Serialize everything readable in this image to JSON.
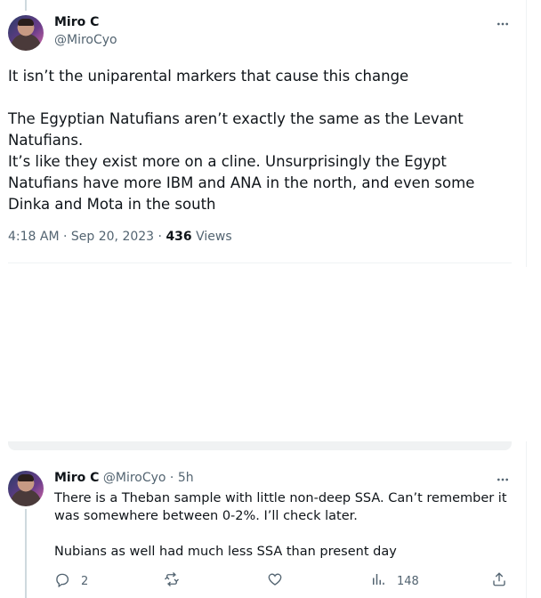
{
  "main_tweet": {
    "author_name": "Miro C",
    "author_handle": "@MiroCyo",
    "paragraphs": [
      "It isn’t the uniparental markers that cause this change",
      "The Egyptian Natufians aren’t exactly the same as the Levant Natufians.",
      "It’s like they exist more on a cline. Unsurprisingly the Egypt Natufians have more IBM and ANA in the north, and even some Dinka and Mota in the south"
    ],
    "timestamp": "4:18 AM · Sep 20, 2023 · ",
    "views_count": "436",
    "views_label": " Views"
  },
  "reply": {
    "author_name": "Miro C",
    "author_handle": "@MiroCyo",
    "separator": " · ",
    "time": "5h",
    "paragraphs": [
      "There is a Theban sample with little non-deep SSA. Can’t remember it was somewhere between 0-2%. I’ll check later.",
      "Nubians as well had much less SSA than present day"
    ],
    "actions": {
      "reply_count": "2",
      "retweet_count": "",
      "like_count": "",
      "views_count": "148"
    }
  },
  "icons": [
    "more-icon",
    "reply-icon",
    "retweet-icon",
    "like-icon",
    "views-icon",
    "share-icon"
  ],
  "colors": {
    "text": "#0f1419",
    "secondary": "#536471",
    "divider": "#eff3f4",
    "thread_line": "#cfd9de"
  }
}
